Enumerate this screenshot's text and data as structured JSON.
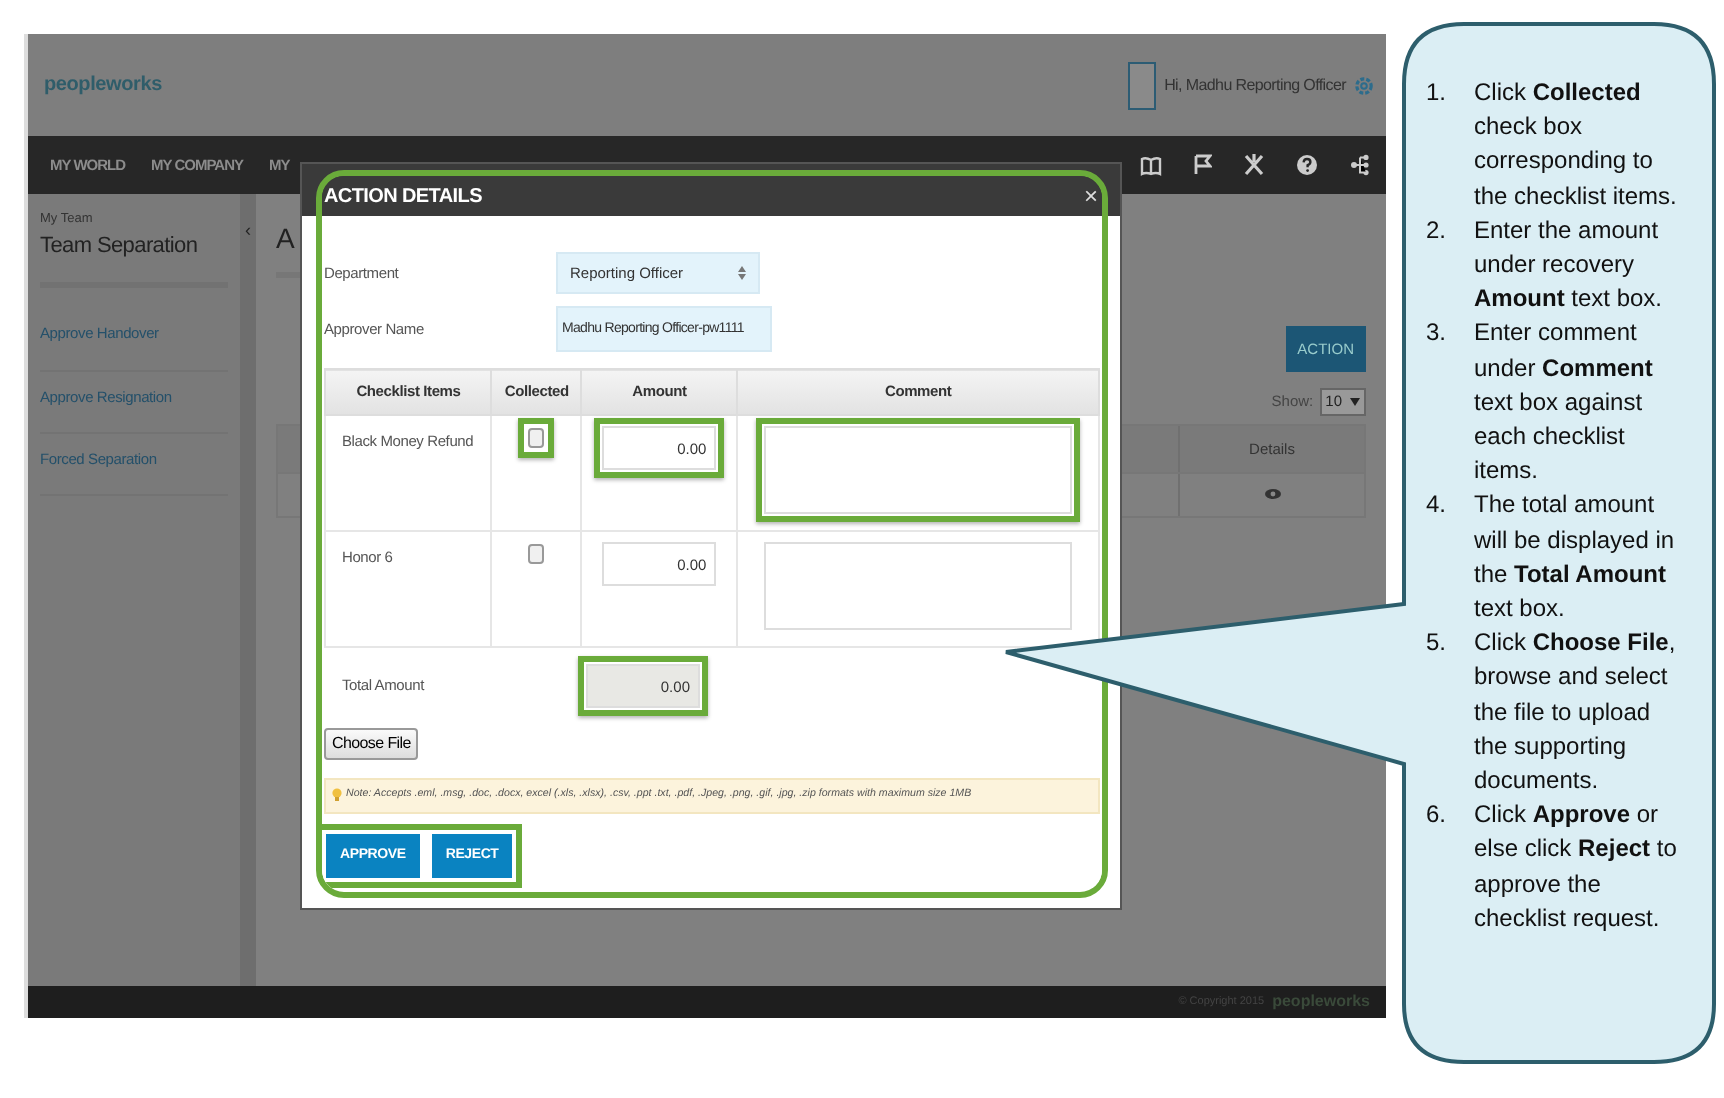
{
  "header": {
    "logo": "peopleworks",
    "greeting": "Hi, Madhu Reporting Officer"
  },
  "nav": {
    "items": [
      "MY WORLD",
      "MY COMPANY",
      "MY"
    ]
  },
  "sidebar": {
    "caption": "My Team",
    "title": "Team Separation",
    "items": [
      "Approve Handover",
      "Approve Resignation",
      "Forced Separation"
    ]
  },
  "collapse_toggle": "‹",
  "content": {
    "heading": "A",
    "action_button": "ACTION",
    "show_label": "Show:",
    "page_size": "10",
    "table": {
      "columns": [
        "Details"
      ]
    }
  },
  "footer": {
    "copyright": "© Copyright 2015",
    "brand": "peopleworks"
  },
  "modal": {
    "title": "ACTION DETAILS",
    "close": "×",
    "highlighted": true,
    "fields": [
      {
        "label": "Department",
        "value": "Reporting Officer",
        "kind": "select"
      },
      {
        "label": "Approver Name",
        "value": "Madhu Reporting Officer-pw1111",
        "kind": "text"
      }
    ],
    "columns": [
      "Checklist Items",
      "Collected",
      "Amount",
      "Comment"
    ],
    "rows": [
      {
        "item": "Black Money Refund",
        "collected": {
          "checked": false,
          "highlighted": true
        },
        "amount": {
          "value": "0.00",
          "highlighted": true
        },
        "comment": {
          "highlighted": true
        }
      },
      {
        "item": "Honor 6",
        "collected": {
          "checked": false,
          "highlighted": false
        },
        "amount": {
          "value": "0.00",
          "highlighted": false
        },
        "comment": {
          "highlighted": false
        }
      }
    ],
    "total": {
      "label": "Total Amount",
      "value": "0.00",
      "highlighted": true
    },
    "file_button": "Choose File",
    "note": "Note: Accepts .eml, .msg, .doc, .docx, excel (.xls, .xlsx), .csv, .ppt .txt, .pdf, .Jpeg, .png, .gif, .jpg, .zip formats with maximum size 1MB",
    "actions": {
      "highlighted": true,
      "buttons": [
        "APPROVE",
        "REJECT"
      ]
    }
  },
  "callout": {
    "steps": [
      {
        "number": "1.",
        "text": "Click **Collected** check box corresponding to the checklist items."
      },
      {
        "number": "2.",
        "text": "Enter the amount under recovery **Amount** text box."
      },
      {
        "number": "3.",
        "text": "Enter comment under **Comment** text box against each checklist items."
      },
      {
        "number": "4.",
        "text": "The total amount will be displayed in the **Total Amount** text box."
      },
      {
        "number": "5.",
        "text": "Click **Choose File**, browse and select the file to upload the supporting documents."
      },
      {
        "number": "6.",
        "text": "Click **Approve** or else click **Reject** to approve the checklist request."
      }
    ]
  }
}
